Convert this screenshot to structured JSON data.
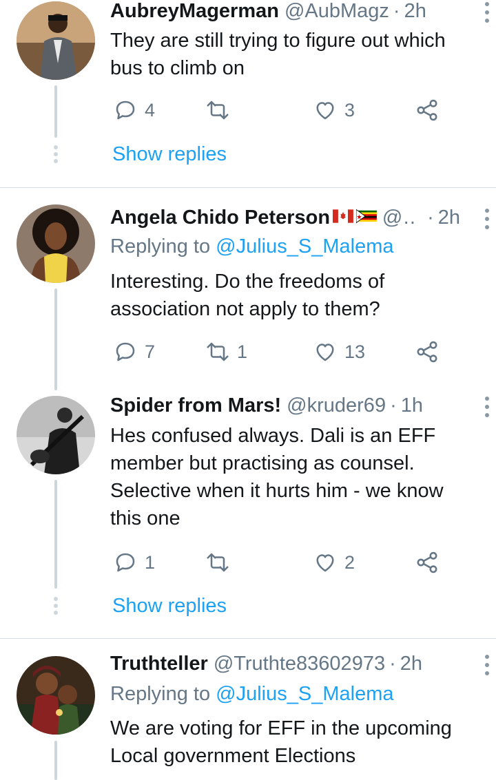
{
  "tweets": [
    {
      "name": "AubreyMagerman",
      "handle": "@AubMagz",
      "separator": "·",
      "time": "2h",
      "text_lines": [
        "They are still trying to figure out which",
        "bus to climb on"
      ],
      "actions": {
        "reply_count": "4",
        "retweet_count": "",
        "like_count": "3"
      },
      "show_replies": "Show replies"
    },
    {
      "name": "Angela Chido Peterson",
      "handle": "@...",
      "separator": "·",
      "time": "2h",
      "replying_prefix": "Replying to",
      "replying_to": "@Julius_S_Malema",
      "text_lines": [
        "Interesting. Do the freedoms of",
        "association not apply to them?"
      ],
      "actions": {
        "reply_count": "7",
        "retweet_count": "1",
        "like_count": "13"
      }
    },
    {
      "name": "Spider from Mars!",
      "handle": "@kruder69",
      "separator": "·",
      "time": "1h",
      "text_lines": [
        "Hes confused always. Dali is an EFF",
        "member but practising as counsel.",
        "Selective when it hurts him - we know",
        "this one"
      ],
      "actions": {
        "reply_count": "1",
        "retweet_count": "",
        "like_count": "2"
      },
      "show_replies": "Show replies"
    },
    {
      "name": "Truthteller",
      "handle": "@Truthte83602973",
      "separator": "·",
      "time": "2h",
      "replying_prefix": "Replying to",
      "replying_to": "@Julius_S_Malema",
      "text_lines": [
        "We are voting for EFF in the upcoming",
        "Local government Elections"
      ]
    }
  ],
  "icons": {
    "reply": "reply-icon",
    "retweet": "retweet-icon",
    "like": "heart-icon",
    "share": "share-icon",
    "more": "more-vertical-icon"
  },
  "colors": {
    "name": "#14171a",
    "muted": "#657786",
    "link": "#1da1f2",
    "icon": "#657786",
    "thread_line": "#ccd6dd"
  }
}
